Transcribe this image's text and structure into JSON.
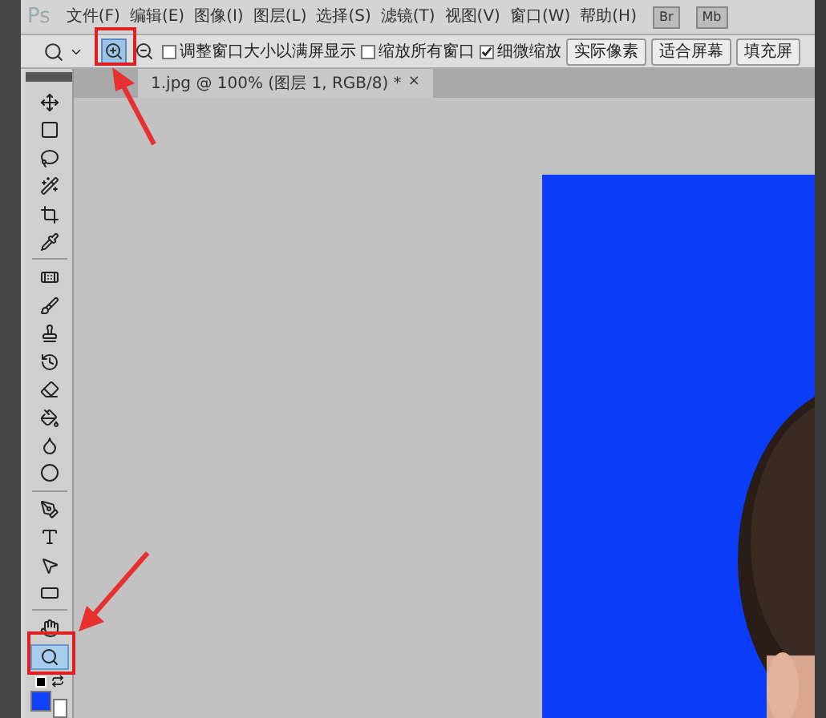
{
  "app": {
    "logo": "Ps"
  },
  "menu": [
    "文件(F)",
    "编辑(E)",
    "图像(I)",
    "图层(L)",
    "选择(S)",
    "滤镜(T)",
    "视图(V)",
    "窗口(W)",
    "帮助(H)"
  ],
  "app_buttons": [
    "Br",
    "Mb"
  ],
  "options": {
    "zoom_modes": [
      {
        "kind": "zoom-in",
        "selected": true
      },
      {
        "kind": "zoom-out",
        "selected": false
      }
    ],
    "checkboxes": [
      {
        "label": "调整窗口大小以满屏显示",
        "checked": false
      },
      {
        "label": "缩放所有窗口",
        "checked": false
      },
      {
        "label": "细微缩放",
        "checked": true
      }
    ],
    "buttons": [
      "实际像素",
      "适合屏幕",
      "填充屏"
    ]
  },
  "document_tab": {
    "title": "1.jpg @ 100% (图层 1, RGB/8) *",
    "close": "×"
  },
  "tools": [
    {
      "kind": "move",
      "selected": false
    },
    {
      "kind": "marquee",
      "selected": false
    },
    {
      "kind": "lasso",
      "selected": false
    },
    {
      "kind": "wand",
      "selected": false
    },
    {
      "kind": "crop",
      "selected": false
    },
    {
      "kind": "eyedropper",
      "selected": false
    },
    {
      "kind": "heal",
      "selected": false
    },
    {
      "kind": "brush",
      "selected": false
    },
    {
      "kind": "stamp",
      "selected": false
    },
    {
      "kind": "history",
      "selected": false
    },
    {
      "kind": "eraser",
      "selected": false
    },
    {
      "kind": "bucket",
      "selected": false
    },
    {
      "kind": "blur",
      "selected": false
    },
    {
      "kind": "dodge",
      "selected": false
    },
    {
      "kind": "pen",
      "selected": false
    },
    {
      "kind": "type",
      "selected": false
    },
    {
      "kind": "select",
      "selected": false
    },
    {
      "kind": "shape",
      "selected": false
    },
    {
      "kind": "hand",
      "selected": false
    },
    {
      "kind": "zoom",
      "selected": true
    }
  ],
  "swatches": [
    {
      "kind": "foreground",
      "color": "#1040f8"
    },
    {
      "kind": "background",
      "color": "#ffffff"
    }
  ]
}
